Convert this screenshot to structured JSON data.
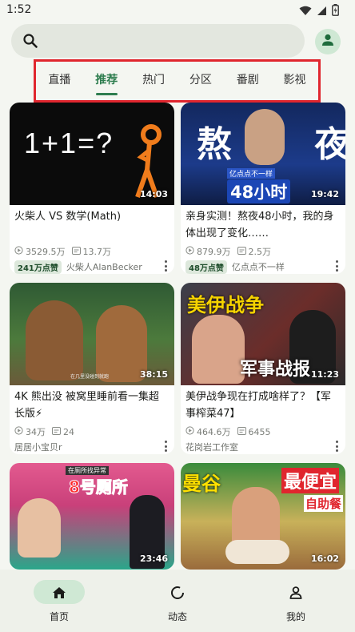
{
  "status_bar": {
    "time": "1:52",
    "icons": [
      "wifi-icon",
      "signal-icon",
      "battery-icon"
    ]
  },
  "search": {
    "placeholder": "",
    "icon": "search-icon"
  },
  "profile": {
    "icon": "person-icon"
  },
  "tabs": [
    {
      "label": "直播",
      "active": false
    },
    {
      "label": "推荐",
      "active": true
    },
    {
      "label": "热门",
      "active": false
    },
    {
      "label": "分区",
      "active": false
    },
    {
      "label": "番剧",
      "active": false
    },
    {
      "label": "影视",
      "active": false
    }
  ],
  "videos": [
    {
      "title": "火柴人 VS 数学(Math)",
      "duration": "14:03",
      "thumb_text": "1+1=?",
      "views": "3529.5万",
      "danmaku": "13.7万",
      "likes_badge": "241万点赞",
      "author": "火柴人AlanBecker"
    },
    {
      "title": "亲身实测！熬夜48小时，我的身体出现了变化……",
      "duration": "19:42",
      "thumb_text": "熬 夜",
      "thumb_subtext": "48小时",
      "thumb_tag": "亿点点不一样",
      "views": "879.9万",
      "danmaku": "2.5万",
      "likes_badge": "48万点赞",
      "author": "亿点点不一样"
    },
    {
      "title": "4K 熊出没 被窝里睡前看一集超长版⚡",
      "duration": "38:15",
      "thumb_caption": "在几里没碰到就跑",
      "views": "34万",
      "danmaku": "24",
      "likes_badge": "",
      "author": "居居小宝贝r"
    },
    {
      "title": "美伊战争现在打成啥样了？【军事榨菜47】",
      "duration": "11:23",
      "thumb_text": "美伊战争",
      "thumb_subtext": "军事战报",
      "views": "464.6万",
      "danmaku": "6455",
      "likes_badge": "",
      "author": "花岗岩工作室"
    },
    {
      "title": "",
      "duration": "23:46",
      "thumb_text": "8号厕所",
      "thumb_tag": "在厕所找异常",
      "views": "",
      "danmaku": "",
      "likes_badge": "",
      "author": ""
    },
    {
      "title": "",
      "duration": "16:02",
      "thumb_text": "曼谷",
      "thumb_subtext": "最便宜",
      "thumb_tag": "自助餐",
      "views": "",
      "danmaku": "",
      "likes_badge": "",
      "author": ""
    }
  ],
  "bottom_nav": [
    {
      "label": "首页",
      "icon": "home-icon",
      "active": true
    },
    {
      "label": "动态",
      "icon": "refresh-icon",
      "active": false
    },
    {
      "label": "我的",
      "icon": "person-icon",
      "active": false
    }
  ],
  "colors": {
    "accent": "#2e7d4f",
    "highlight_border": "#e0262e",
    "background": "#f4f6f1"
  }
}
